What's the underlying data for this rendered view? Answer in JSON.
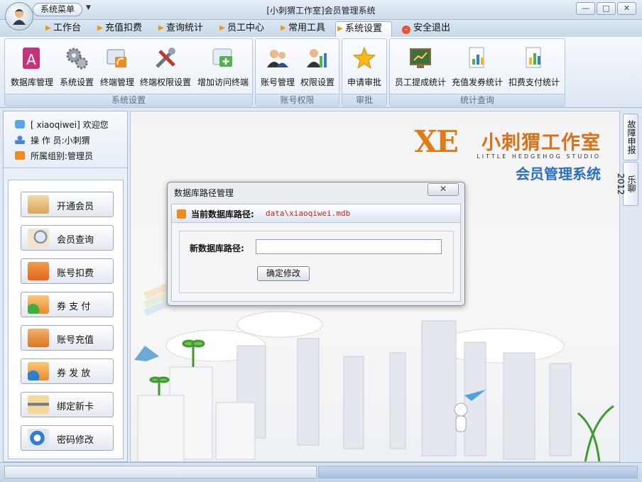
{
  "window": {
    "system_menu_label": "系统菜单",
    "title": "[小刺猬工作室]会员管理系统",
    "controls": [
      "—",
      "□",
      "✕"
    ]
  },
  "menu": {
    "tabs": [
      "工作台",
      "充值扣费",
      "查询统计",
      "员工中心",
      "常用工具",
      "系统设置"
    ],
    "active_tab": "系统设置",
    "exit_label": "安全退出"
  },
  "ribbon": {
    "groups": [
      {
        "label": "系统设置",
        "buttons": [
          "数据库管理",
          "系统设置",
          "终端管理",
          "终端权限设置",
          "增加访问终端"
        ]
      },
      {
        "label": "账号权限",
        "buttons": [
          "账号管理",
          "权限设置"
        ]
      },
      {
        "label": "审批",
        "buttons": [
          "申请审批"
        ]
      },
      {
        "label": "统计查询",
        "buttons": [
          "员工提成统计",
          "充值发券统计",
          "扣费支付统计"
        ]
      }
    ]
  },
  "user": {
    "welcome": "[ xiaoqiwei] 欢迎您",
    "operator": "操 作 员:小刺猬",
    "group": "所属组别:管理员"
  },
  "nav": {
    "buttons": [
      "开通会员",
      "会员查询",
      "账号扣费",
      "券 支 付",
      "账号充值",
      "券 发 放",
      "绑定新卡",
      "密码修改"
    ]
  },
  "brand": {
    "logo_mark": "XE",
    "title": "小刺猬工作室",
    "english": "LITTLE HEDGEHOG STUDIO",
    "subtitle": "会员管理系统"
  },
  "side_tabs": [
    "故障申报",
    "乐聊2012"
  ],
  "dialog": {
    "title": "数据库路径管理",
    "close_label": "✕",
    "current_path_label": "当前数据库路径:",
    "current_path_value": "data\\xiaoqiwei.mdb",
    "new_path_label": "新数据库路径:",
    "new_path_value": "",
    "confirm_label": "确定修改"
  },
  "colors": {
    "accent_orange": "#e07a14",
    "brand_blue": "#2c6ec4",
    "path_red": "#c2281f"
  }
}
